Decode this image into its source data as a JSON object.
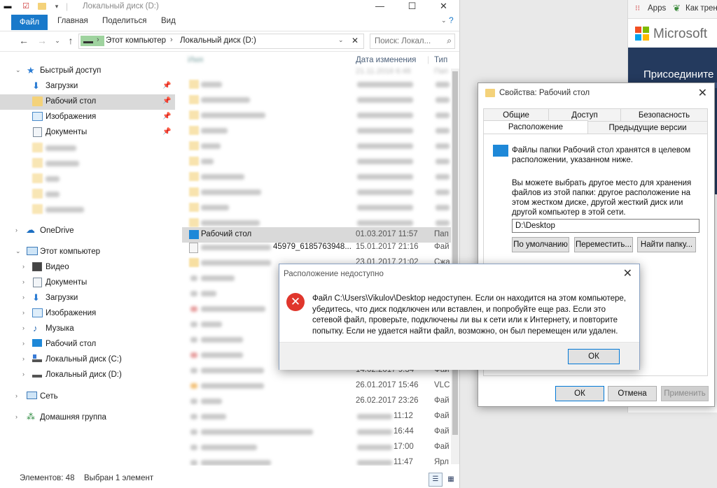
{
  "explorer": {
    "title": "Локальный диск (D:)",
    "ribbon_tabs": [
      "Файл",
      "Главная",
      "Поделиться",
      "Вид"
    ],
    "address": {
      "computer": "Этот компьютер",
      "drive": "Локальный диск (D:)"
    },
    "search_placeholder": "Поиск: Локал...",
    "nav": {
      "quick_access": "Быстрый доступ",
      "quick_items": [
        "Загрузки",
        "Рабочий стол",
        "Изображения",
        "Документы"
      ],
      "onedrive": "OneDrive",
      "this_pc": "Этот компьютер",
      "pc_items": [
        "Видео",
        "Документы",
        "Загрузки",
        "Изображения",
        "Музыка",
        "Рабочий стол",
        "Локальный диск (C:)",
        "Локальный диск (D:)"
      ],
      "network": "Сеть",
      "homegroup": "Домашняя группа"
    },
    "columns": {
      "name": "Имя",
      "date": "Дата изменения",
      "type": "Тип"
    },
    "top_date_partial": "21.11.2016 6:48",
    "top_type_partial": "Пап",
    "rows": [
      {
        "name": "Рабочий стол",
        "date": "01.03.2017 11:57",
        "type": "Пап"
      },
      {
        "name": "45979_6185763948...",
        "date": "15.01.2017 21:16",
        "type": "Фай"
      },
      {
        "name": "",
        "date": "23.01.2017 21:02",
        "type": "Сжа"
      }
    ],
    "lower_rows": [
      {
        "date": "14.02.2017 9:34",
        "type": "Фай"
      },
      {
        "date": "26.01.2017 15:46",
        "type": "VLC"
      },
      {
        "date": "26.02.2017 23:26",
        "type": "Фай"
      },
      {
        "date": "11:12",
        "type": "Фай"
      },
      {
        "date": "16:44",
        "type": "Фай"
      },
      {
        "date": "17:00",
        "type": "Фай"
      },
      {
        "date": "11:47",
        "type": "Ярл"
      }
    ],
    "status": {
      "count": "Элементов: 48",
      "selected": "Выбран 1 элемент"
    }
  },
  "browser": {
    "bookmarks": [
      "Apps",
      "Как трен"
    ],
    "brand": "Microsoft",
    "banner_text": "Присоедините"
  },
  "properties_dialog": {
    "title": "Свойства: Рабочий стол",
    "tabs_row1": [
      "Общие",
      "Доступ",
      "Безопасность"
    ],
    "tabs_row2": [
      "Расположение",
      "Предыдущие версии"
    ],
    "text1": "Файлы папки Рабочий стол хранятся в целевом расположении, указанном ниже.",
    "text2": "Вы можете выбрать другое место для хранения файлов из этой папки: другое расположение на этом жестком диске, другой жесткий диск или другой компьютер в этой сети.",
    "path_value": "D:\\Desktop",
    "buttons": {
      "default": "По умолчанию",
      "move": "Переместить...",
      "find": "Найти папку..."
    },
    "footer": {
      "ok": "ОК",
      "cancel": "Отмена",
      "apply": "Применить"
    }
  },
  "error_dialog": {
    "title": "Расположение недоступно",
    "message": "Файл C:\\Users\\Vikulov\\Desktop недоступен. Если он находится на этом компьютере, убедитесь, что диск подключен или вставлен, и попробуйте еще раз. Если это сетевой файл, проверьте, подключены ли вы к сети или к Интернету, и повторите попытку. Если не удается найти файл, возможно, он был перемещен или удален.",
    "ok": "ОК"
  },
  "colors": {
    "accent": "#1979ca",
    "error_red": "#e0362c",
    "ms_banner": "#243a5e"
  }
}
